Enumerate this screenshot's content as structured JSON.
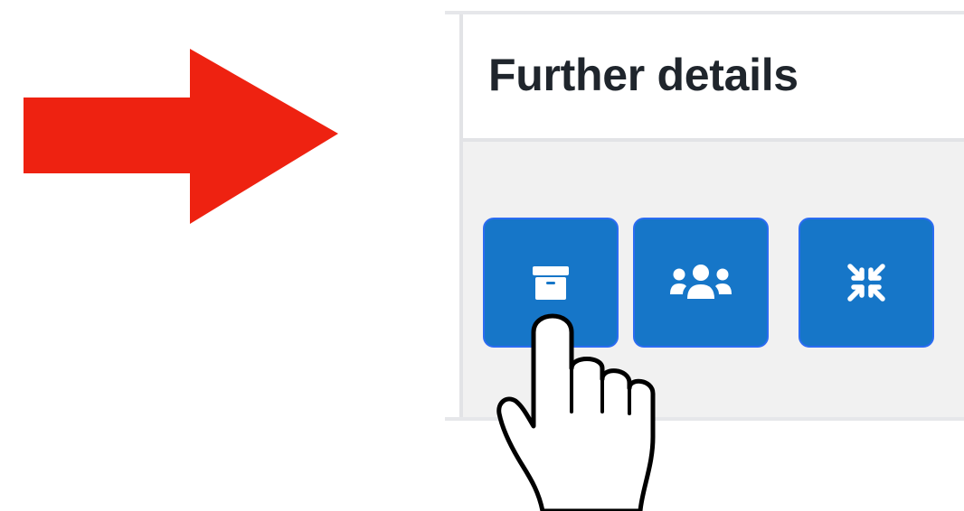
{
  "panel": {
    "title": "Further details"
  },
  "toolbar": {
    "buttons": [
      {
        "name": "archive-button",
        "icon": "archive-box-icon"
      },
      {
        "name": "users-button",
        "icon": "users-group-icon"
      },
      {
        "name": "compress-button",
        "icon": "compress-arrows-icon"
      }
    ]
  },
  "colors": {
    "arrow": "#ee2211",
    "button": "#1676c8",
    "button_border": "#2b6cf2",
    "panel_body": "#f1f1f1",
    "title_text": "#1f252c"
  },
  "pointer": {
    "icon": "hand-pointer-icon"
  }
}
